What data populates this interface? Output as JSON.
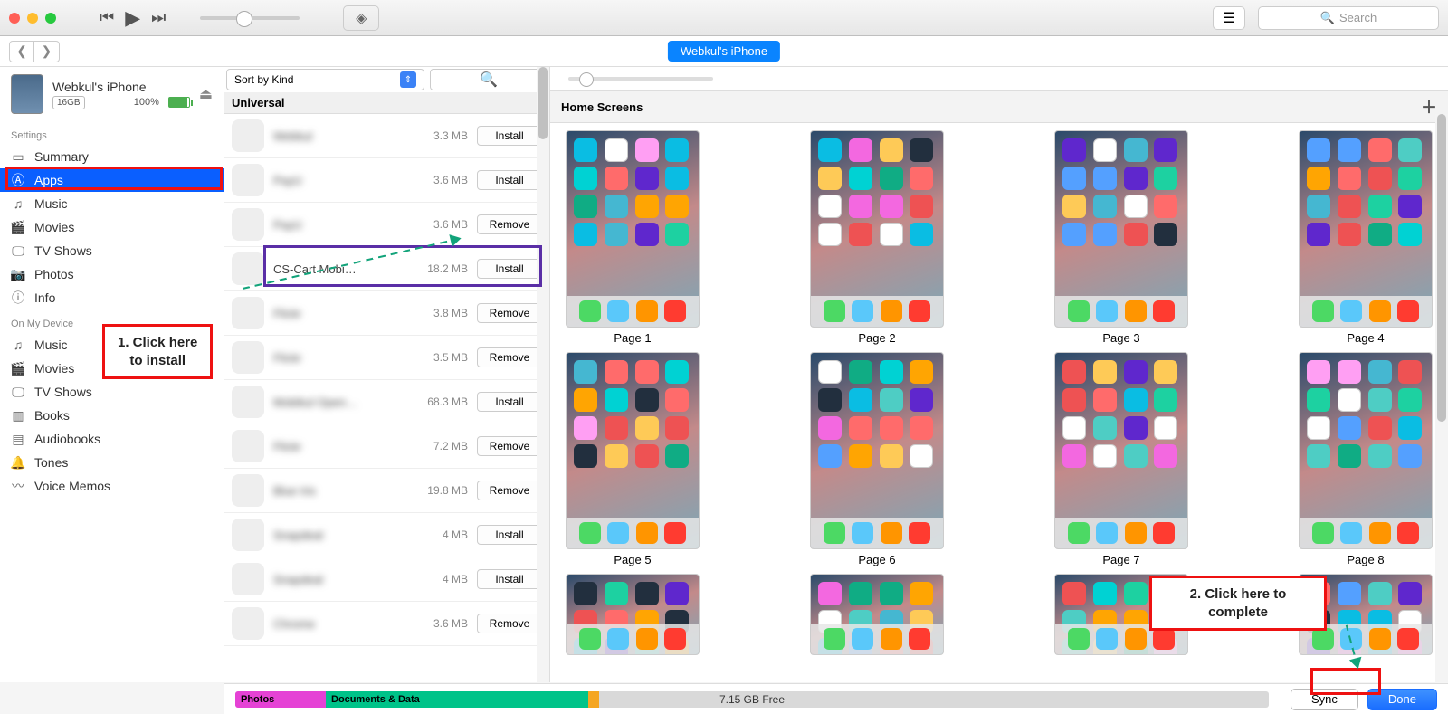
{
  "toolbar": {
    "search_placeholder": "Search"
  },
  "subbar": {
    "device_pill": "Webkul's iPhone"
  },
  "sidebar": {
    "device": {
      "name": "Webkul's iPhone",
      "capacity": "16GB",
      "battery_pct": "100%"
    },
    "settings_label": "Settings",
    "settings_items": [
      "Summary",
      "Apps",
      "Music",
      "Movies",
      "TV Shows",
      "Photos",
      "Info"
    ],
    "device_label": "On My Device",
    "device_items": [
      "Music",
      "Movies",
      "TV Shows",
      "Books",
      "Audiobooks",
      "Tones",
      "Voice Memos"
    ]
  },
  "apps_col": {
    "sort_label": "Sort by Kind",
    "section": "Universal",
    "rows": [
      {
        "name": "Webkul",
        "size": "3.3 MB",
        "action": "Install",
        "clear": false
      },
      {
        "name": "PayU",
        "size": "3.6 MB",
        "action": "Install",
        "clear": false
      },
      {
        "name": "PayU",
        "size": "3.6 MB",
        "action": "Remove",
        "clear": false
      },
      {
        "name": "CS-Cart Mobi…",
        "size": "18.2 MB",
        "action": "Install",
        "clear": true
      },
      {
        "name": "Flickr",
        "size": "3.8 MB",
        "action": "Remove",
        "clear": false
      },
      {
        "name": "Flickr",
        "size": "3.5 MB",
        "action": "Remove",
        "clear": false
      },
      {
        "name": "Mobikul Open…",
        "size": "68.3 MB",
        "action": "Install",
        "clear": false
      },
      {
        "name": "Flickr",
        "size": "7.2 MB",
        "action": "Remove",
        "clear": false
      },
      {
        "name": "Blue Iris",
        "size": "19.8 MB",
        "action": "Remove",
        "clear": false
      },
      {
        "name": "Snapdeal",
        "size": "4 MB",
        "action": "Install",
        "clear": false
      },
      {
        "name": "Snapdeal",
        "size": "4 MB",
        "action": "Install",
        "clear": false
      },
      {
        "name": "Chrome",
        "size": "3.6 MB",
        "action": "Remove",
        "clear": false
      }
    ]
  },
  "home_screens": {
    "title": "Home Screens",
    "pages": [
      "Page 1",
      "Page 2",
      "Page 3",
      "Page 4",
      "Page 5",
      "Page 6",
      "Page 7",
      "Page 8"
    ]
  },
  "bottom": {
    "seg_photos": "Photos",
    "seg_docs": "Documents & Data",
    "free": "7.15 GB Free",
    "sync": "Sync",
    "done": "Done"
  },
  "annotations": {
    "step1": "1. Click here\nto install",
    "step2": "2. Click here to\ncomplete"
  }
}
